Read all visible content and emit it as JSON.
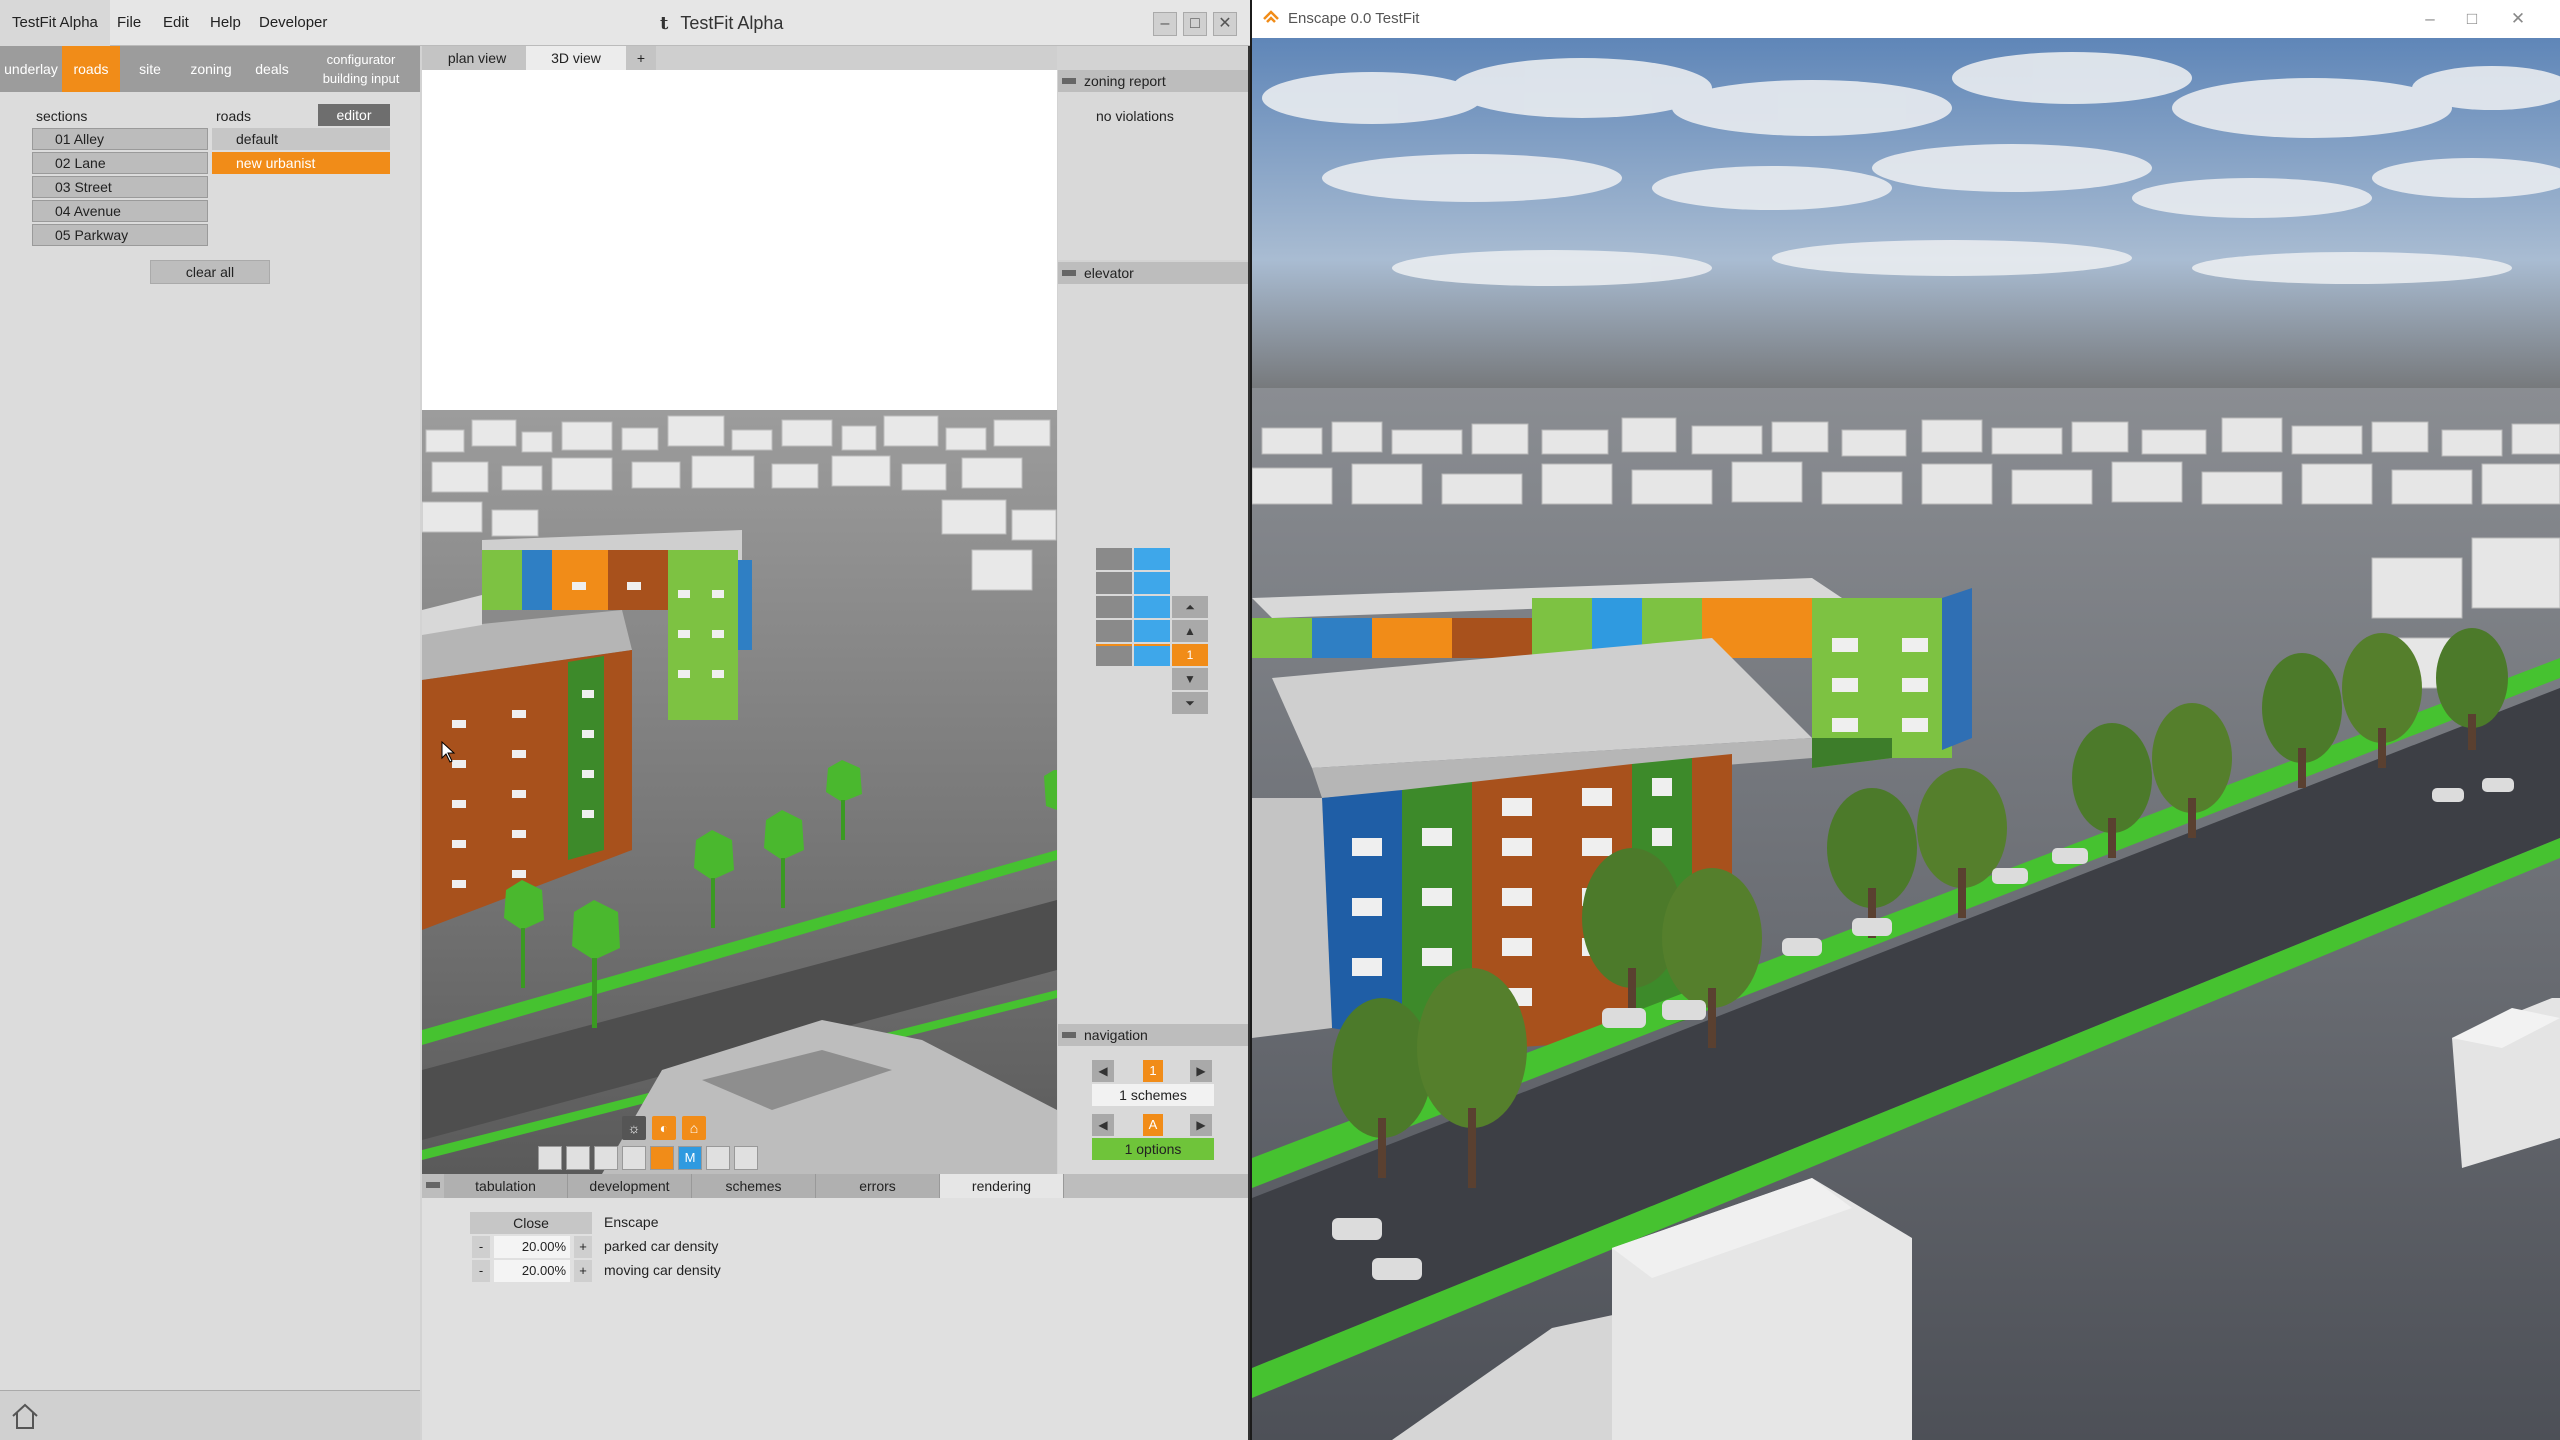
{
  "testfit": {
    "menu": [
      "TestFit Alpha",
      "File",
      "Edit",
      "Help",
      "Developer"
    ],
    "window_title": "TestFit Alpha",
    "window_logo": "t",
    "window_controls": [
      "minimize-icon",
      "maximize-icon",
      "close-icon"
    ],
    "top_tabs": [
      {
        "label": "underlay",
        "active": false
      },
      {
        "label": "roads",
        "active": true
      },
      {
        "label": "site",
        "active": false
      },
      {
        "label": "zoning",
        "active": false
      },
      {
        "label": "deals",
        "active": false
      }
    ],
    "configurator_tab": {
      "line1": "configurator",
      "line2": "building input"
    },
    "sections_label": "sections",
    "sections": [
      "01 Alley",
      "02 Lane",
      "03 Street",
      "04 Avenue",
      "05 Parkway"
    ],
    "roads_label": "roads",
    "editor_button": "editor",
    "roads": [
      {
        "label": "default",
        "active": false
      },
      {
        "label": "new urbanist",
        "active": true
      }
    ],
    "clear_all": "clear all",
    "view_tabs": [
      {
        "label": "plan view",
        "active": false
      },
      {
        "label": "3D view",
        "active": true
      },
      {
        "label": "+",
        "active": false
      }
    ],
    "zoning_report": {
      "title": "zoning report",
      "status": "no violations"
    },
    "elevator": {
      "title": "elevator",
      "floor": "1"
    },
    "navigation": {
      "title": "navigation",
      "scheme_value": "1",
      "schemes_label": "1 schemes",
      "option_value": "A",
      "options_label": "1 options"
    },
    "bottom_tabs": [
      {
        "label": "tabulation",
        "active": false
      },
      {
        "label": "development",
        "active": false
      },
      {
        "label": "schemes",
        "active": false
      },
      {
        "label": "errors",
        "active": false
      },
      {
        "label": "rendering",
        "active": true
      }
    ],
    "rendering": {
      "close_button": "Close",
      "engine_label": "Enscape",
      "parked_value": "20.00%",
      "parked_label": "parked car density",
      "moving_value": "20.00%",
      "moving_label": "moving car density",
      "minus": "-",
      "plus": "+"
    },
    "toolbar_icons": [
      "sun-icon",
      "contrast-icon",
      "home-outline-icon",
      "building-icon",
      "layers-icon",
      "floor-plan-icon",
      "stack-icon",
      "cube-icon",
      "measure-icon",
      "angle-icon",
      "expand-icon",
      "triangle-icon"
    ]
  },
  "enscape": {
    "window_title": "Enscape 0.0 TestFit",
    "controls": [
      "minimize-icon",
      "maximize-icon",
      "close-icon"
    ]
  },
  "colors": {
    "accent": "#f18c18",
    "building_brown": "#a8511c",
    "building_green": "#7dc242",
    "building_blue": "#2f7fc4",
    "grass": "#46c230"
  }
}
